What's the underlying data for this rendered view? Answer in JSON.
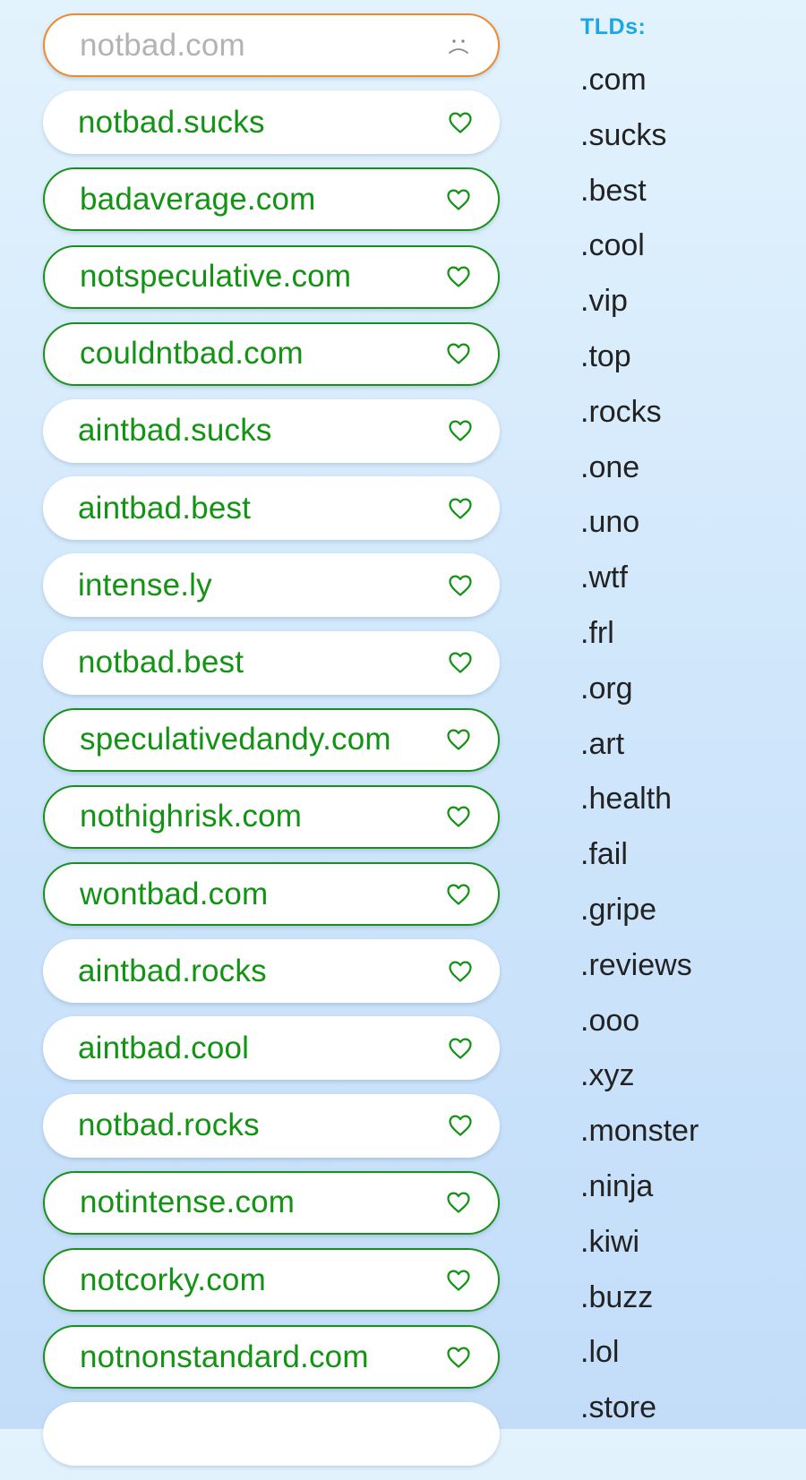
{
  "search_result": {
    "domain": "notbad.com",
    "status_icon": "sad-face-icon"
  },
  "suggestions": [
    {
      "domain": "notbad.sucks",
      "outlined": false,
      "icon": "heart-icon"
    },
    {
      "domain": "badaverage.com",
      "outlined": true,
      "icon": "heart-icon"
    },
    {
      "domain": "notspeculative.com",
      "outlined": true,
      "icon": "heart-icon"
    },
    {
      "domain": "couldntbad.com",
      "outlined": true,
      "icon": "heart-icon"
    },
    {
      "domain": "aintbad.sucks",
      "outlined": false,
      "icon": "heart-icon"
    },
    {
      "domain": "aintbad.best",
      "outlined": false,
      "icon": "heart-icon"
    },
    {
      "domain": "intense.ly",
      "outlined": false,
      "icon": "heart-icon"
    },
    {
      "domain": "notbad.best",
      "outlined": false,
      "icon": "heart-icon"
    },
    {
      "domain": "speculativedandy.com",
      "outlined": true,
      "icon": "heart-icon"
    },
    {
      "domain": "nothighrisk.com",
      "outlined": true,
      "icon": "heart-icon"
    },
    {
      "domain": "wontbad.com",
      "outlined": true,
      "icon": "heart-icon"
    },
    {
      "domain": "aintbad.rocks",
      "outlined": false,
      "icon": "heart-icon"
    },
    {
      "domain": "aintbad.cool",
      "outlined": false,
      "icon": "heart-icon"
    },
    {
      "domain": "notbad.rocks",
      "outlined": false,
      "icon": "heart-icon"
    },
    {
      "domain": "notintense.com",
      "outlined": true,
      "icon": "heart-icon"
    },
    {
      "domain": "notcorky.com",
      "outlined": true,
      "icon": "heart-icon"
    },
    {
      "domain": "notnonstandard.com",
      "outlined": true,
      "icon": "heart-icon"
    },
    {
      "domain": "",
      "outlined": false,
      "icon": ""
    }
  ],
  "tld_panel": {
    "title": "TLDs:",
    "items": [
      ".com",
      ".sucks",
      ".best",
      ".cool",
      ".vip",
      ".top",
      ".rocks",
      ".one",
      ".uno",
      ".wtf",
      ".frl",
      ".org",
      ".art",
      ".health",
      ".fail",
      ".gripe",
      ".reviews",
      ".ooo",
      ".xyz",
      ".monster",
      ".ninja",
      ".kiwi",
      ".buzz",
      ".lol",
      ".store"
    ]
  },
  "colors": {
    "available_green": "#139313",
    "taken_orange": "#ee8a2c",
    "taken_text_gray": "#b3b3b3",
    "tld_title_blue": "#1aa7e6"
  }
}
